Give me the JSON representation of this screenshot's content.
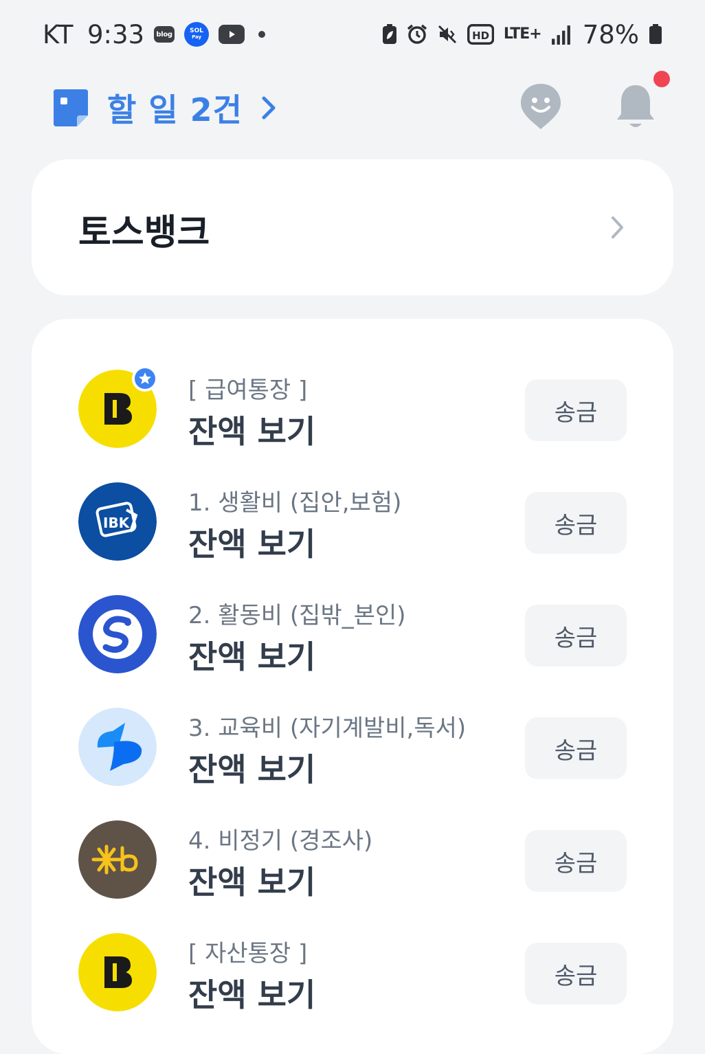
{
  "status_bar": {
    "carrier": "KT",
    "time": "9:33",
    "apps": [
      {
        "name": "blog",
        "label": "blog"
      },
      {
        "name": "sol-pay",
        "label_top": "SOL",
        "label_bottom": "Pay"
      },
      {
        "name": "youtube"
      }
    ],
    "network": "LTE+",
    "battery": "78%",
    "icons": [
      "battery-saver-icon",
      "alarm-icon",
      "vibrate-mute-icon",
      "hd-icon",
      "lte-icon",
      "signal-icon",
      "battery-icon"
    ]
  },
  "header": {
    "todo_label": "할 일 2건",
    "notification_dot": true,
    "colors": {
      "accent": "#3c80e6",
      "dot": "#f04452"
    }
  },
  "bank": {
    "title": "토스뱅크"
  },
  "accounts": [
    {
      "name": "[ 급여통장 ]",
      "balance_label": "잔액 보기",
      "send_label": "송금",
      "logo": "kbank-logo",
      "logo_color": "#f6df00",
      "favorite": true
    },
    {
      "name": "1. 생활비 (집안,보험)",
      "balance_label": "잔액 보기",
      "send_label": "송금",
      "logo": "ibk-logo",
      "logo_color": "#0b4ea2",
      "favorite": false
    },
    {
      "name": "2. 활동비 (집밖_본인)",
      "balance_label": "잔액 보기",
      "send_label": "송금",
      "logo": "shinhan-logo",
      "logo_color": "#2a55cf",
      "favorite": false
    },
    {
      "name": "3. 교육비 (자기계발비,독서)",
      "balance_label": "잔액 보기",
      "send_label": "송금",
      "logo": "toss-logo",
      "logo_color": "#d6e8fb",
      "favorite": false
    },
    {
      "name": "4. 비정기 (경조사)",
      "balance_label": "잔액 보기",
      "send_label": "송금",
      "logo": "kb-logo",
      "logo_color": "#5f5347",
      "favorite": false
    },
    {
      "name": "[ 자산통장 ]",
      "balance_label": "잔액 보기",
      "send_label": "송금",
      "logo": "kbank-logo",
      "logo_color": "#f6df00",
      "favorite": false
    }
  ]
}
